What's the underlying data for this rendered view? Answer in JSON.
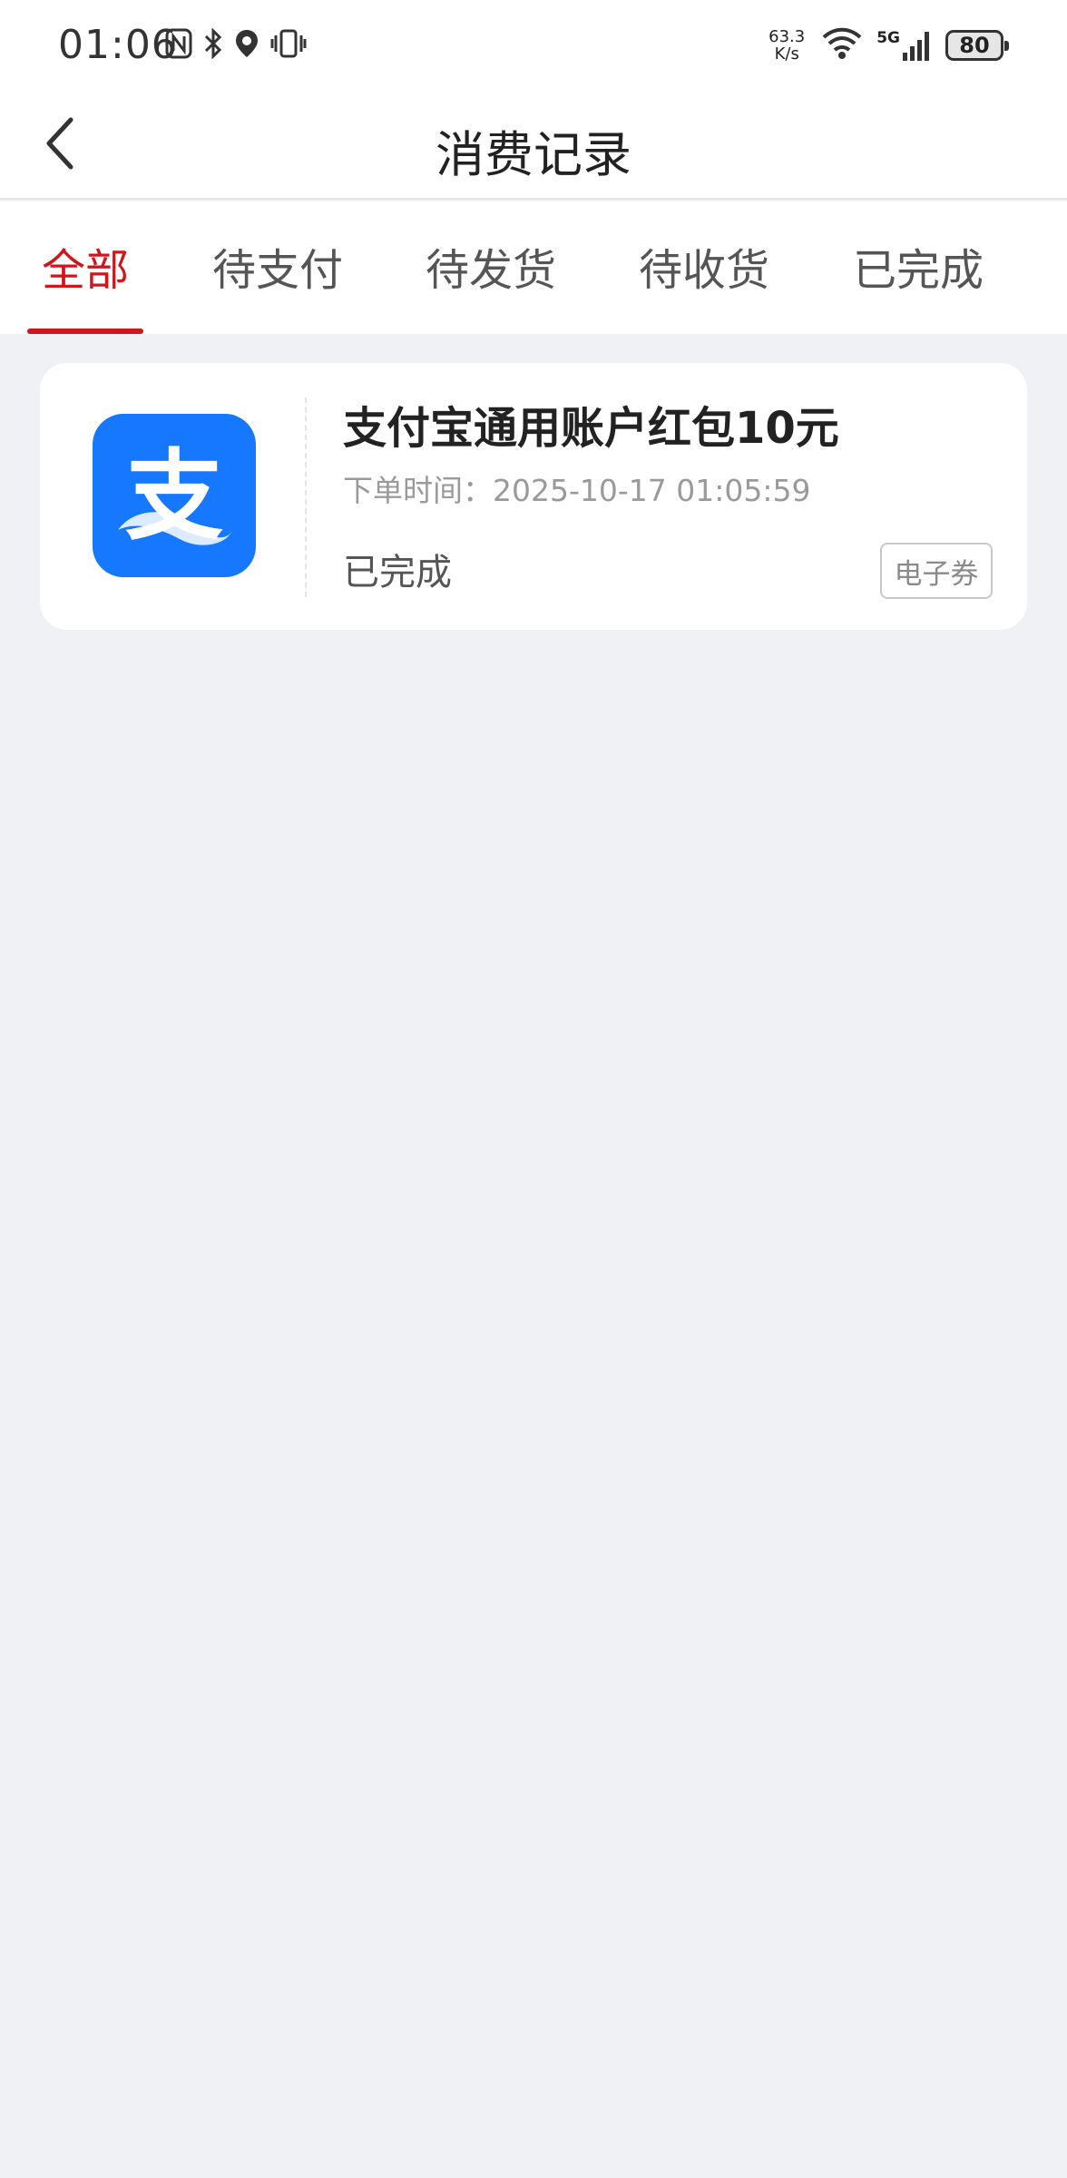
{
  "status_bar": {
    "time": "01:06",
    "net_speed_value": "63.3",
    "net_speed_unit": "K/s",
    "network_type": "5G",
    "battery": "80",
    "icons": [
      "nfc-icon",
      "bluetooth-icon",
      "location-icon",
      "vibrate-icon",
      "wifi-icon",
      "signal-icon",
      "battery-icon"
    ]
  },
  "nav": {
    "title": "消费记录",
    "back_icon": "chevron-left-icon"
  },
  "tabs": [
    {
      "label": "全部",
      "active": true
    },
    {
      "label": "待支付",
      "active": false
    },
    {
      "label": "待发货",
      "active": false
    },
    {
      "label": "待收货",
      "active": false
    },
    {
      "label": "已完成",
      "active": false
    }
  ],
  "orders": [
    {
      "title": "支付宝通用账户红包10元",
      "time_label": "下单时间：",
      "time_value": "2025-10-17 01:05:59",
      "status": "已完成",
      "tag": "电子券",
      "thumb_icon": "alipay-logo-icon",
      "thumb_glyph": "支"
    }
  ],
  "colors": {
    "accent": "#d0161c",
    "alipay_blue": "#1677ff",
    "page_bg": "#f0f1f4"
  }
}
